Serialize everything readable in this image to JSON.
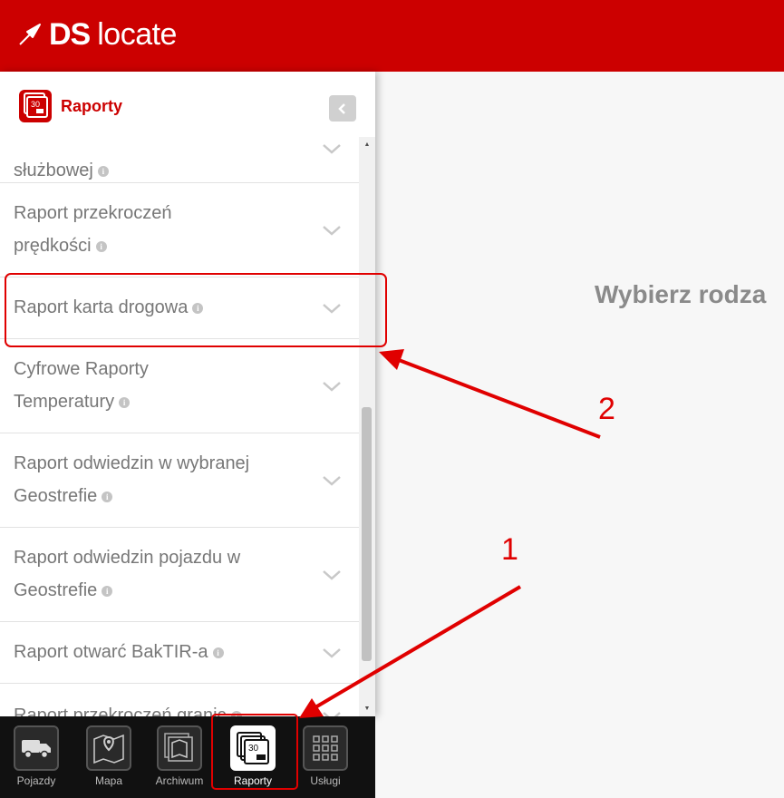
{
  "app": {
    "logo_bold": "DS",
    "logo_light": "locate"
  },
  "panel": {
    "title": "Raporty",
    "icon_badge": "30",
    "items": [
      {
        "lines": [
          "służbowej"
        ]
      },
      {
        "lines": [
          "Raport przekroczeń",
          "prędkości"
        ]
      },
      {
        "lines": [
          "Raport karta drogowa"
        ]
      },
      {
        "lines": [
          "Cyfrowe Raporty",
          "Temperatury"
        ]
      },
      {
        "lines": [
          "Raport odwiedzin w wybranej",
          "Geostrefie"
        ]
      },
      {
        "lines": [
          "Raport odwiedzin pojazdu w",
          "Geostrefie"
        ]
      },
      {
        "lines": [
          "Raport otwarć BakTIR-a"
        ]
      },
      {
        "lines": [
          "Raport przekroczeń granic"
        ]
      }
    ]
  },
  "main": {
    "message": "Wybierz rodza"
  },
  "bottom_nav": [
    {
      "label": "Pojazdy",
      "icon": "truck-icon"
    },
    {
      "label": "Mapa",
      "icon": "map-icon"
    },
    {
      "label": "Archiwum",
      "icon": "archive-icon"
    },
    {
      "label": "Raporty",
      "icon": "reports-icon",
      "active": true
    },
    {
      "label": "Usługi",
      "icon": "grid-icon"
    }
  ],
  "annotations": {
    "label_1": "1",
    "label_2": "2",
    "color": "#e00000"
  },
  "colors": {
    "brand": "#cc0000",
    "bottom_bar": "#111111"
  }
}
